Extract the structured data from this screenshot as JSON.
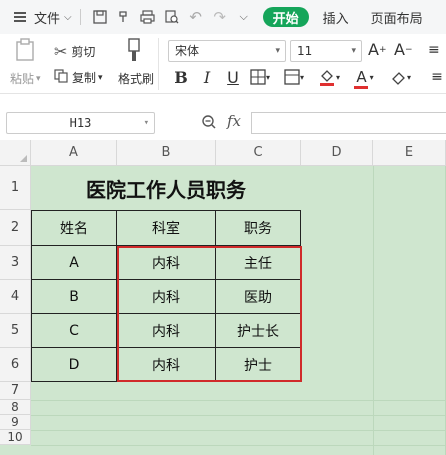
{
  "menubar": {
    "file_label": "文件",
    "tabs": [
      "开始",
      "插入",
      "页面布局"
    ]
  },
  "ribbon": {
    "paste_label": "粘贴",
    "cut_label": "剪切",
    "copy_label": "复制",
    "format_painter_label": "格式刷",
    "font_name": "宋体",
    "font_size": "11"
  },
  "formula_bar": {
    "cell_ref": "H13",
    "fx_label": "fx",
    "content": ""
  },
  "sheet": {
    "columns": [
      "A",
      "B",
      "C",
      "D",
      "E"
    ],
    "rows": [
      "1",
      "2",
      "3",
      "4",
      "5",
      "6",
      "7",
      "8",
      "9",
      "10"
    ],
    "title": "医院工作人员职务",
    "headers": [
      "姓名",
      "科室",
      "职务"
    ],
    "data": [
      [
        "A",
        "内科",
        "主任"
      ],
      [
        "B",
        "内科",
        "医助"
      ],
      [
        "C",
        "内科",
        "护士长"
      ],
      [
        "D",
        "内科",
        "护士"
      ]
    ]
  },
  "colors": {
    "accent": "#15a55a",
    "sheet_background": "#cfe6cf",
    "selection_border": "#d02a2a"
  }
}
